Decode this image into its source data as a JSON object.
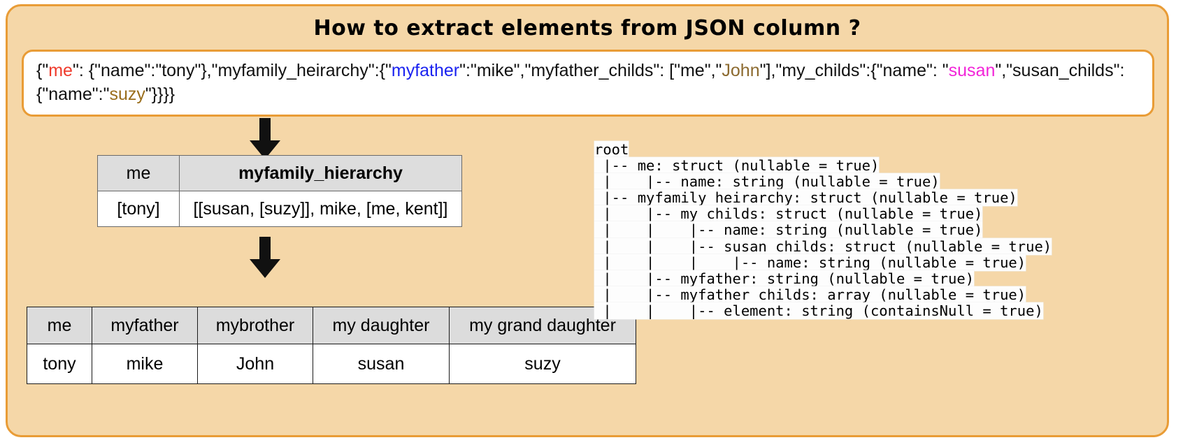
{
  "slide": {
    "title": "How to extract elements from JSON column ?",
    "background_color": "#f5d7a8",
    "border_color": "#e99c36"
  },
  "json_box": {
    "segments": [
      {
        "text": "{\"",
        "color": "#111111"
      },
      {
        "text": "me",
        "color": "#ef3b2c"
      },
      {
        "text": "\": {\"name\":\"tony\"},\"myfamily_heirarchy\":{\"",
        "color": "#111111"
      },
      {
        "text": "myfather",
        "color": "#1b23f0"
      },
      {
        "text": "\":\"mike\",\"myfather_childs\": [\"me\",\"",
        "color": "#111111"
      },
      {
        "text": "John",
        "color": "#8c6a2f"
      },
      {
        "text": "\"],\"my_childs\":{\"name\": \"",
        "color": "#111111"
      },
      {
        "text": "susan",
        "color": "#f224d8"
      },
      {
        "text": "\",\"susan_childs\":{\"name\":\"",
        "color": "#111111"
      },
      {
        "text": "suzy",
        "color": "#9a6e1c"
      },
      {
        "text": "\"}}}}",
        "color": "#111111"
      }
    ],
    "full_text": "{\"me\": {\"name\":\"tony\"},\"myfamily_heirarchy\":{\"myfather\":\"mike\",\"myfather_childs\": [\"me\",\"John\"],\"my_childs\":{\"name\": \"susan\",\"susan_childs\":{\"name\":\"suzy\"}}}}"
  },
  "table1": {
    "headers": [
      "me",
      "myfamily_hierarchy"
    ],
    "rows": [
      [
        "[tony]",
        "[[susan, [suzy]], mike, [me, kent]]"
      ]
    ]
  },
  "table2": {
    "headers": [
      "me",
      "myfather",
      "mybrother",
      "my daughter",
      "my grand daughter"
    ],
    "header_colors": [
      "#ef3b2c",
      "#1b23f0",
      "#000000",
      "#000000",
      "#000000"
    ],
    "rows": [
      [
        "tony",
        "mike",
        "John",
        "susan",
        "suzy"
      ]
    ],
    "row_colors": [
      "#000000",
      "#000000",
      "#93702e",
      "#ee2fe0",
      "#7c1212"
    ]
  },
  "schema": {
    "lines": [
      "root",
      " |-- me: struct (nullable = true)",
      " |    |-- name: string (nullable = true)",
      " |-- myfamily_heirarchy: struct (nullable = true)",
      " |    |-- my_childs: struct (nullable = true)",
      " |    |    |-- name: string (nullable = true)",
      " |    |    |-- susan_childs: struct (nullable = true)",
      " |    |    |    |-- name: string (nullable = true)",
      " |    |-- myfather: string (nullable = true)",
      " |    |-- myfather_childs: array (nullable = true)",
      " |    |    |-- element: string (containsNull = true)"
    ]
  },
  "arrows": {
    "arrow1_label": "down-arrow",
    "arrow2_label": "down-arrow"
  }
}
